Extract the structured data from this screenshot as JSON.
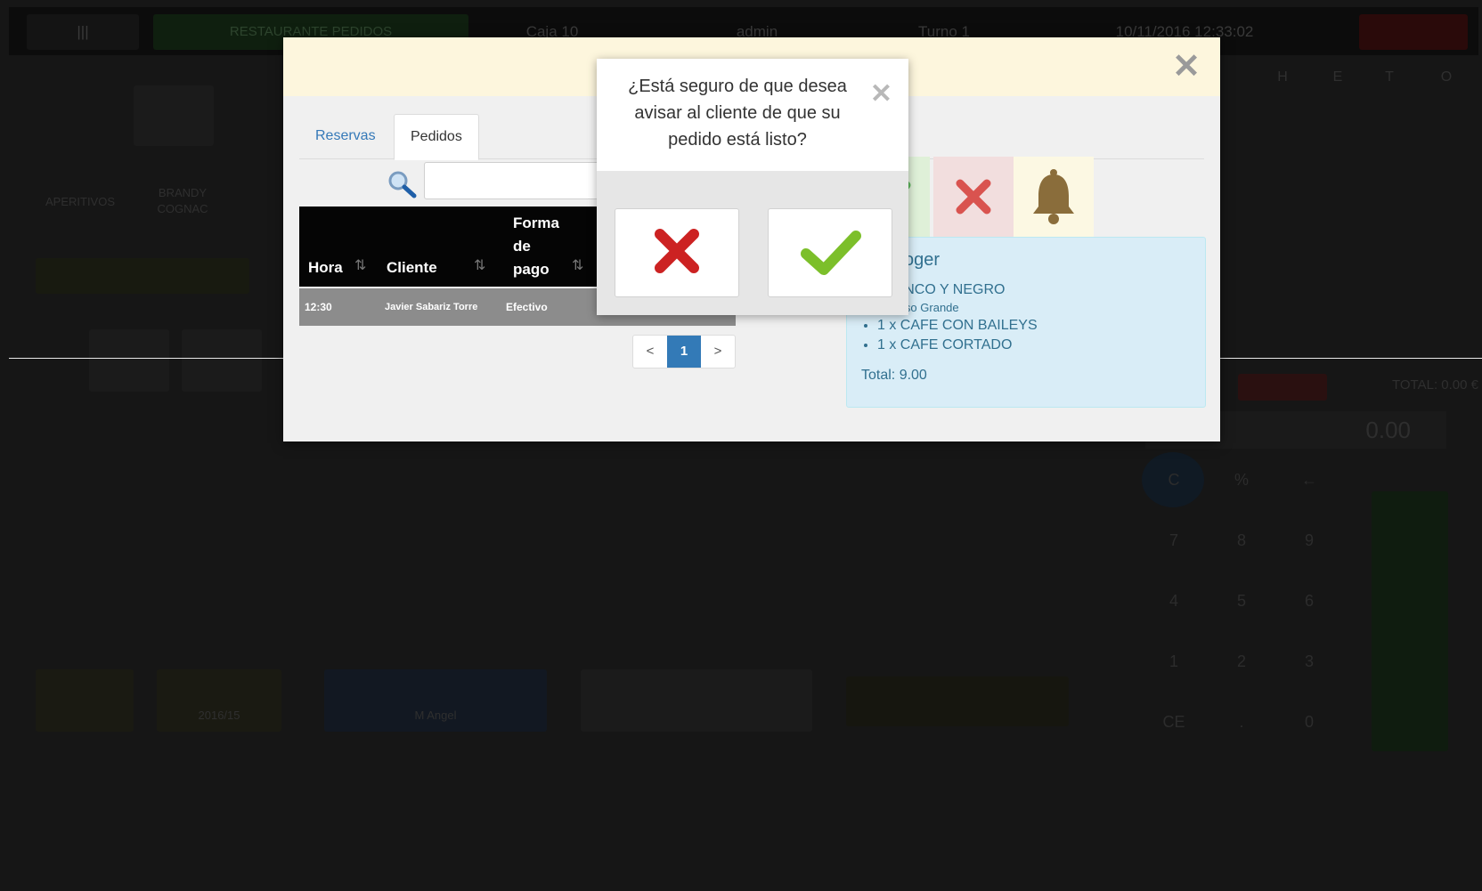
{
  "background": {
    "topbar": {
      "grid_label": "|||",
      "section": "RESTAURANTE PEDIDOS",
      "user": "admin",
      "table": "Caja 10",
      "turn": "Turno 1",
      "datetime": "10/11/2016 12:33:02"
    },
    "categories": [
      "APERITIVOS",
      "BRANDY COGNAC"
    ],
    "bottom_labels": [
      "2016/15",
      "M Angel"
    ],
    "total": "TOTAL: 0.00 €",
    "display": "0.00",
    "keypad": [
      "C",
      "%",
      "←",
      "7",
      "8",
      "9",
      "4",
      "5",
      "6",
      "1",
      "2",
      "3",
      "CE",
      ".",
      "0"
    ],
    "letters": [
      "H",
      "E",
      "T",
      "O"
    ]
  },
  "modal": {
    "close_glyph": "✕",
    "tabs": [
      {
        "label": "Reservas",
        "active": false
      },
      {
        "label": "Pedidos",
        "active": true
      }
    ],
    "search": {
      "value": "",
      "placeholder": ""
    },
    "table": {
      "headers": [
        "Hora",
        "Cliente",
        "Forma de pago"
      ],
      "header_forma_lines": [
        "Forma",
        "de",
        "pago"
      ],
      "rows": [
        {
          "hora": "12:30",
          "cliente": "Javier Sabariz Torre",
          "forma_pago": "Efectivo"
        }
      ]
    },
    "pagination": {
      "prev": "<",
      "current": "1",
      "next": ">"
    },
    "actions": {
      "accept_color": "#5cb85c",
      "reject_color": "#d9534f",
      "notify_color": "#8a6d3b"
    },
    "order": {
      "title": "oger",
      "items": [
        {
          "text": "BLANCO Y NEGRO",
          "note": "Vaso Grande"
        },
        {
          "text": "1 x CAFE CON BAILEYS"
        },
        {
          "text": "1 x CAFE CORTADO"
        }
      ],
      "total": "Total: 9.00"
    }
  },
  "confirm": {
    "question": "¿Está seguro de que desea avisar al cliente de que su pedido está listo?",
    "close_glyph": "✕",
    "cancel_color": "#cc2222",
    "ok_color": "#7cbf2a"
  }
}
